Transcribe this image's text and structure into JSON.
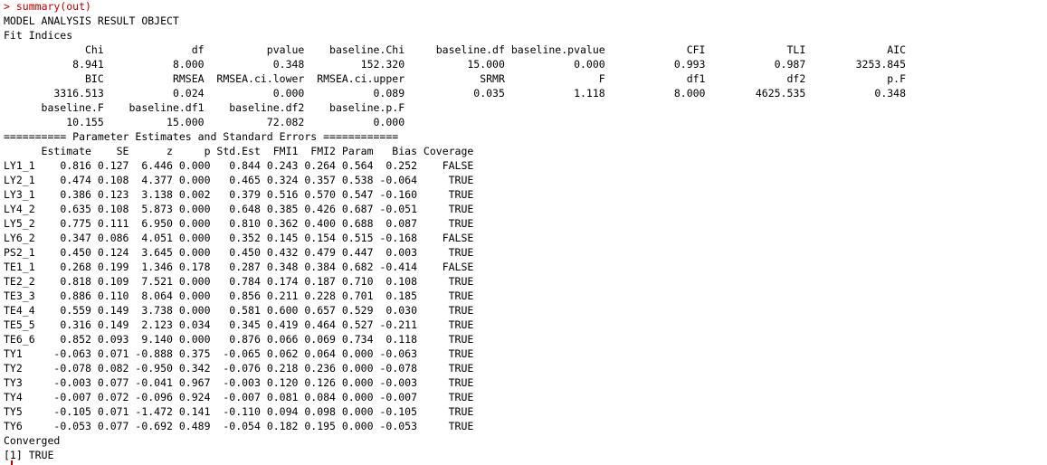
{
  "console": {
    "prompt": ">",
    "command": "summary(out)",
    "title": "MODEL ANALYSIS RESULT OBJECT",
    "fit_header": "Fit Indices",
    "fit_indices": [
      {
        "name": "Chi",
        "value": "8.941"
      },
      {
        "name": "df",
        "value": "8.000"
      },
      {
        "name": "pvalue",
        "value": "0.348"
      },
      {
        "name": "baseline.Chi",
        "value": "152.320"
      },
      {
        "name": "baseline.df",
        "value": "15.000"
      },
      {
        "name": "baseline.pvalue",
        "value": "0.000"
      },
      {
        "name": "CFI",
        "value": "0.993"
      },
      {
        "name": "TLI",
        "value": "0.987"
      },
      {
        "name": "AIC",
        "value": "3253.845"
      },
      {
        "name": "BIC",
        "value": "3316.513"
      },
      {
        "name": "RMSEA",
        "value": "0.024"
      },
      {
        "name": "RMSEA.ci.lower",
        "value": "0.000"
      },
      {
        "name": "RMSEA.ci.upper",
        "value": "0.089"
      },
      {
        "name": "SRMR",
        "value": "0.035"
      },
      {
        "name": "F",
        "value": "1.118"
      },
      {
        "name": "df1",
        "value": "8.000"
      },
      {
        "name": "df2",
        "value": "4625.535"
      },
      {
        "name": "p.F",
        "value": "0.348"
      },
      {
        "name": "baseline.F",
        "value": "10.155"
      },
      {
        "name": "baseline.df1",
        "value": "15.000"
      },
      {
        "name": "baseline.df2",
        "value": "72.082"
      },
      {
        "name": "baseline.p.F",
        "value": "0.000"
      }
    ],
    "param_header": "========== Parameter Estimates and Standard Errors ============",
    "param_columns": [
      "Estimate",
      "SE",
      "z",
      "p",
      "Std.Est",
      "FMI1",
      "FMI2",
      "Param",
      "Bias",
      "Coverage"
    ],
    "params": [
      {
        "label": "LY1_1",
        "values": [
          "0.816",
          "0.127",
          "6.446",
          "0.000",
          "0.844",
          "0.243",
          "0.264",
          "0.564",
          "0.252",
          "FALSE"
        ]
      },
      {
        "label": "LY2_1",
        "values": [
          "0.474",
          "0.108",
          "4.377",
          "0.000",
          "0.465",
          "0.324",
          "0.357",
          "0.538",
          "-0.064",
          "TRUE"
        ]
      },
      {
        "label": "LY3_1",
        "values": [
          "0.386",
          "0.123",
          "3.138",
          "0.002",
          "0.379",
          "0.516",
          "0.570",
          "0.547",
          "-0.160",
          "TRUE"
        ]
      },
      {
        "label": "LY4_2",
        "values": [
          "0.635",
          "0.108",
          "5.873",
          "0.000",
          "0.648",
          "0.385",
          "0.426",
          "0.687",
          "-0.051",
          "TRUE"
        ]
      },
      {
        "label": "LY5_2",
        "values": [
          "0.775",
          "0.111",
          "6.950",
          "0.000",
          "0.810",
          "0.362",
          "0.400",
          "0.688",
          "0.087",
          "TRUE"
        ]
      },
      {
        "label": "LY6_2",
        "values": [
          "0.347",
          "0.086",
          "4.051",
          "0.000",
          "0.352",
          "0.145",
          "0.154",
          "0.515",
          "-0.168",
          "FALSE"
        ]
      },
      {
        "label": "PS2_1",
        "values": [
          "0.450",
          "0.124",
          "3.645",
          "0.000",
          "0.450",
          "0.432",
          "0.479",
          "0.447",
          "0.003",
          "TRUE"
        ]
      },
      {
        "label": "TE1_1",
        "values": [
          "0.268",
          "0.199",
          "1.346",
          "0.178",
          "0.287",
          "0.348",
          "0.384",
          "0.682",
          "-0.414",
          "FALSE"
        ]
      },
      {
        "label": "TE2_2",
        "values": [
          "0.818",
          "0.109",
          "7.521",
          "0.000",
          "0.784",
          "0.174",
          "0.187",
          "0.710",
          "0.108",
          "TRUE"
        ]
      },
      {
        "label": "TE3_3",
        "values": [
          "0.886",
          "0.110",
          "8.064",
          "0.000",
          "0.856",
          "0.211",
          "0.228",
          "0.701",
          "0.185",
          "TRUE"
        ]
      },
      {
        "label": "TE4_4",
        "values": [
          "0.559",
          "0.149",
          "3.738",
          "0.000",
          "0.581",
          "0.600",
          "0.657",
          "0.529",
          "0.030",
          "TRUE"
        ]
      },
      {
        "label": "TE5_5",
        "values": [
          "0.316",
          "0.149",
          "2.123",
          "0.034",
          "0.345",
          "0.419",
          "0.464",
          "0.527",
          "-0.211",
          "TRUE"
        ]
      },
      {
        "label": "TE6_6",
        "values": [
          "0.852",
          "0.093",
          "9.140",
          "0.000",
          "0.876",
          "0.066",
          "0.069",
          "0.734",
          "0.118",
          "TRUE"
        ]
      },
      {
        "label": "TY1",
        "values": [
          "-0.063",
          "0.071",
          "-0.888",
          "0.375",
          "-0.065",
          "0.062",
          "0.064",
          "0.000",
          "-0.063",
          "TRUE"
        ]
      },
      {
        "label": "TY2",
        "values": [
          "-0.078",
          "0.082",
          "-0.950",
          "0.342",
          "-0.076",
          "0.218",
          "0.236",
          "0.000",
          "-0.078",
          "TRUE"
        ]
      },
      {
        "label": "TY3",
        "values": [
          "-0.003",
          "0.077",
          "-0.041",
          "0.967",
          "-0.003",
          "0.120",
          "0.126",
          "0.000",
          "-0.003",
          "TRUE"
        ]
      },
      {
        "label": "TY4",
        "values": [
          "-0.007",
          "0.072",
          "-0.096",
          "0.924",
          "-0.007",
          "0.081",
          "0.084",
          "0.000",
          "-0.007",
          "TRUE"
        ]
      },
      {
        "label": "TY5",
        "values": [
          "-0.105",
          "0.071",
          "-1.472",
          "0.141",
          "-0.110",
          "0.094",
          "0.098",
          "0.000",
          "-0.105",
          "TRUE"
        ]
      },
      {
        "label": "TY6",
        "values": [
          "-0.053",
          "0.077",
          "-0.692",
          "0.489",
          "-0.054",
          "0.182",
          "0.195",
          "0.000",
          "-0.053",
          "TRUE"
        ]
      }
    ],
    "converged_header": "Converged",
    "converged_index": "[1]",
    "converged_value": "TRUE"
  },
  "colors": {
    "background": "#ffffff",
    "text": "#000000",
    "prompt": "#c00000"
  }
}
